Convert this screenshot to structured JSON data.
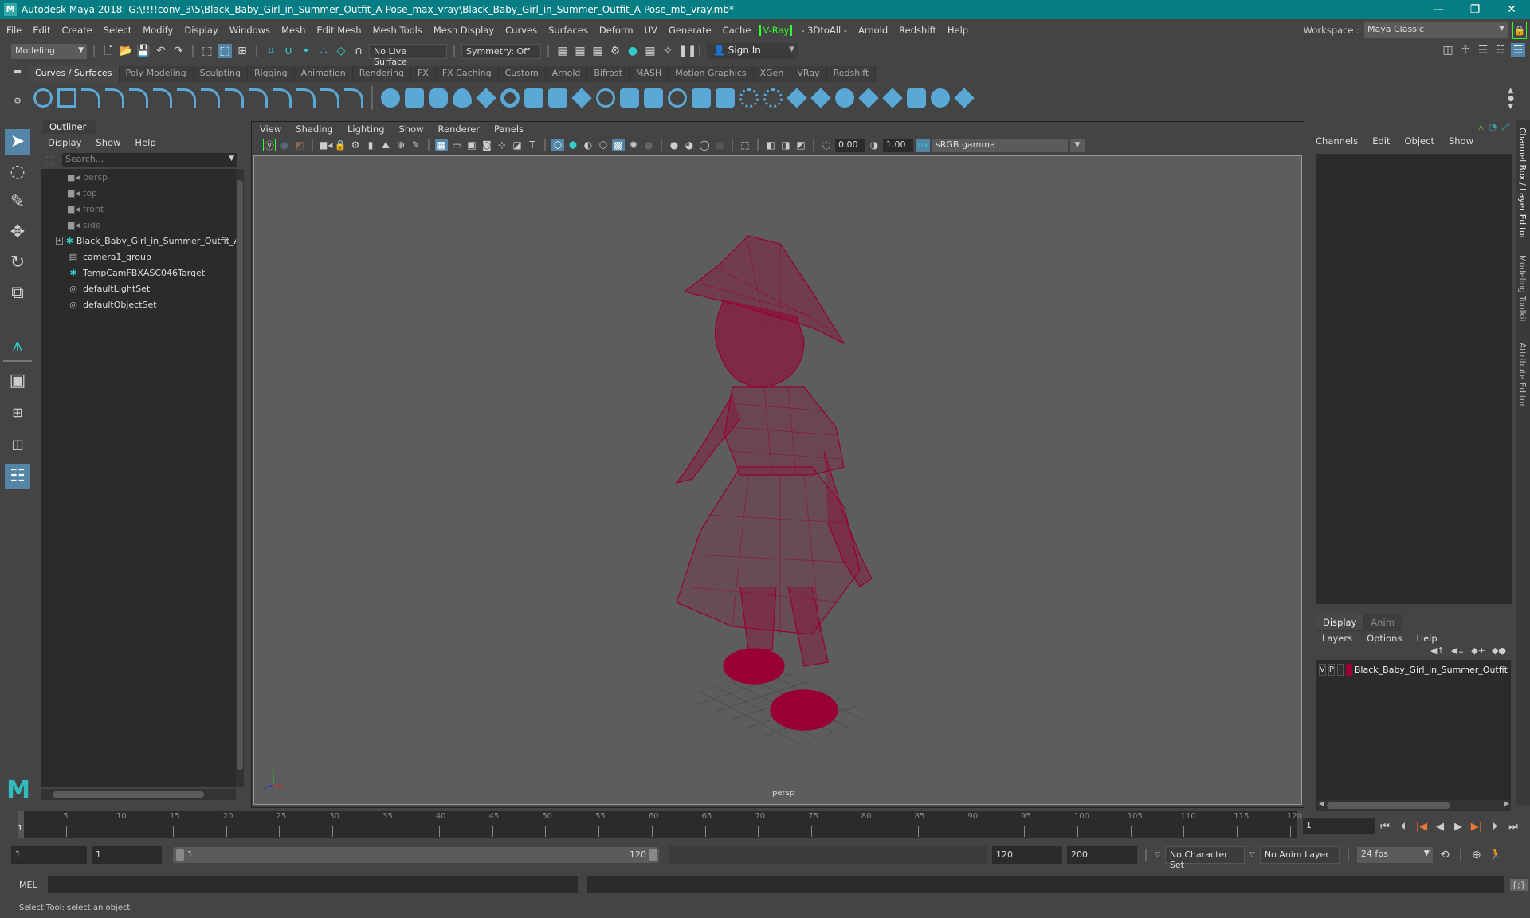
{
  "title": "Autodesk Maya 2018: G:\\!!!!conv_3\\5\\Black_Baby_Girl_in_Summer_Outfit_A-Pose_max_vray\\Black_Baby_Girl_in_Summer_Outfit_A-Pose_mb_vray.mb*",
  "window_controls": {
    "minimize": "—",
    "maximize": "❐",
    "close": "✕"
  },
  "menubar": [
    "File",
    "Edit",
    "Create",
    "Select",
    "Modify",
    "Display",
    "Windows",
    "Mesh",
    "Edit Mesh",
    "Mesh Tools",
    "Mesh Display",
    "Curves",
    "Surfaces",
    "Deform",
    "UV",
    "Generate",
    "Cache",
    "V-Ray",
    "- 3DtoAll -",
    "Arnold",
    "Redshift",
    "Help"
  ],
  "workspace": {
    "label": "Workspace :",
    "value": "Maya Classic"
  },
  "statusline": {
    "mode": "Modeling",
    "live_surface": "No Live Surface",
    "symmetry": "Symmetry: Off",
    "sign_in": "Sign In"
  },
  "shelf_tabs": [
    "Curves / Surfaces",
    "Poly Modeling",
    "Sculpting",
    "Rigging",
    "Animation",
    "Rendering",
    "FX",
    "FX Caching",
    "Custom",
    "Arnold",
    "Bifrost",
    "MASH",
    "Motion Graphics",
    "XGen",
    "VRay",
    "Redshift"
  ],
  "shelf_active": "Curves / Surfaces",
  "outliner": {
    "title": "Outliner",
    "menu": [
      "Display",
      "Show",
      "Help"
    ],
    "search_placeholder": "Search...",
    "items": [
      {
        "name": "persp",
        "icon": "camera-icon",
        "dim": true
      },
      {
        "name": "top",
        "icon": "camera-icon",
        "dim": true
      },
      {
        "name": "front",
        "icon": "camera-icon",
        "dim": true
      },
      {
        "name": "side",
        "icon": "camera-icon",
        "dim": true
      },
      {
        "name": "Black_Baby_Girl_in_Summer_Outfit_A",
        "icon": "transform-icon",
        "expandable": true
      },
      {
        "name": "camera1_group",
        "icon": "group-icon"
      },
      {
        "name": "TempCamFBXASC046Target",
        "icon": "transform-icon"
      },
      {
        "name": "defaultLightSet",
        "icon": "set-icon"
      },
      {
        "name": "defaultObjectSet",
        "icon": "set-icon"
      }
    ]
  },
  "viewport": {
    "menu": [
      "View",
      "Shading",
      "Lighting",
      "Show",
      "Renderer",
      "Panels"
    ],
    "exposure": "0.00",
    "gamma": "1.00",
    "color_space": "sRGB gamma",
    "camera_name": "persp",
    "wire_color": "#990033"
  },
  "channelbox": {
    "menu": [
      "Channels",
      "Edit",
      "Object",
      "Show"
    ]
  },
  "layer_editor": {
    "tabs": [
      "Display",
      "Anim"
    ],
    "menu": [
      "Layers",
      "Options",
      "Help"
    ],
    "layers": [
      {
        "v": "V",
        "p": "P",
        "name": "Black_Baby_Girl_in_Summer_Outfit",
        "color": "#990033"
      }
    ]
  },
  "side_tabs": [
    "Channel Box / Layer Editor",
    "Modeling Toolkit",
    "Attribute Editor"
  ],
  "timeline": {
    "start": 1,
    "end": 120,
    "current": "1",
    "labels": [
      5,
      10,
      15,
      20,
      25,
      30,
      35,
      40,
      45,
      50,
      55,
      60,
      65,
      70,
      75,
      80,
      85,
      90,
      95,
      100,
      105,
      110,
      115,
      120
    ]
  },
  "range": {
    "start": "1",
    "anim_start": "1",
    "slider_start": "1",
    "slider_end": "120",
    "playback_end": "120",
    "anim_end": "200",
    "character_set": "No Character Set",
    "anim_layer": "No Anim Layer",
    "fps": "24 fps"
  },
  "command_line": {
    "lang": "MEL"
  },
  "help_line": "Select Tool: select an object"
}
